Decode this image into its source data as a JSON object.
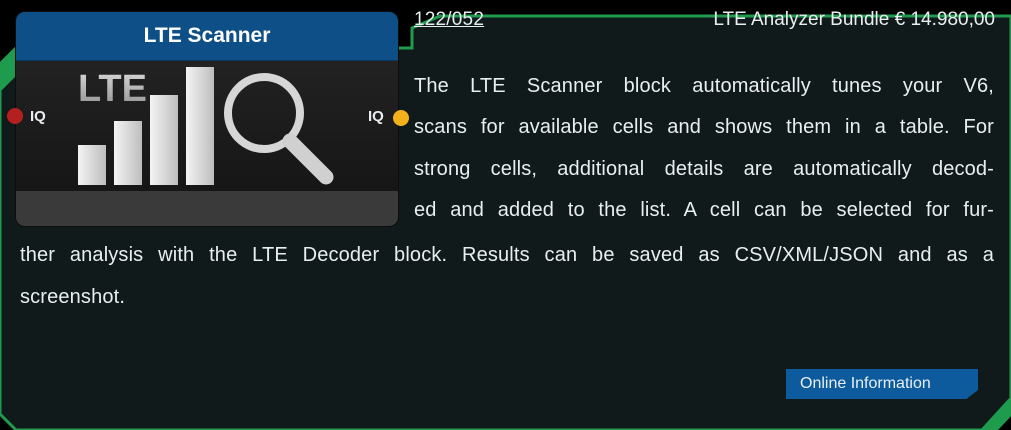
{
  "header": {
    "article_number": "122/052",
    "bundle_text": "LTE Analyzer Bundle € 14.980,00"
  },
  "block": {
    "title": "LTE Scanner",
    "icon_text": "LTE",
    "input_port_label": "IQ",
    "output_port_label": "IQ"
  },
  "description": {
    "lines": [
      "The LTE Scanner block automatically tunes your V6,",
      "scans for available cells and shows them in a table. For",
      "strong cells, additional details are automatically decod-",
      "ed and added to the list. A cell can be selected for fur-",
      "ther analysis with the LTE Decoder block. Results can be saved as CSV/XML/JSON and as a",
      "screenshot."
    ]
  },
  "actions": {
    "online_info_label": "Online Information"
  },
  "colors": {
    "frame_green": "#1f9b4e",
    "panel_bg": "#111a1b",
    "card_title_blue": "#0d4f86",
    "button_blue": "#0d5a9c",
    "input_port": "#b3201f",
    "output_port": "#f3b21b"
  },
  "icons": [
    "signal-bars-icon",
    "magnifier-icon"
  ]
}
